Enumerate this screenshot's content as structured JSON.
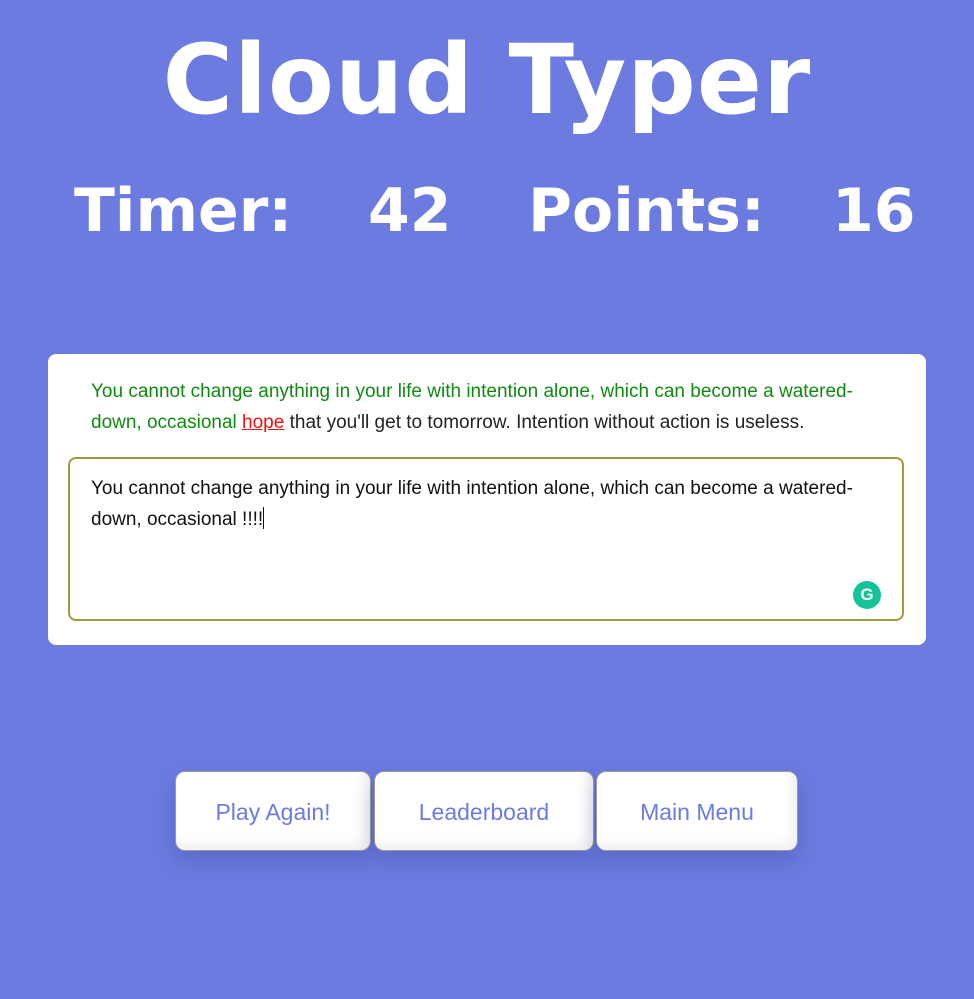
{
  "header": {
    "title": "Cloud Typer"
  },
  "stats": {
    "timer_label": "Timer:",
    "timer_value": "42",
    "points_label": "Points:",
    "points_value": "16"
  },
  "prompt": {
    "typed_correct": "You cannot change anything in your life with intention alone, which can become a watered-down, occasional",
    "current_word": "hope",
    "remaining": "that you'll get to tomorrow. Intention without action is useless."
  },
  "input": {
    "value": "You cannot change anything in your life with intention alone, which can become a watered-down, occasional !!!!"
  },
  "buttons": {
    "play_again": "Play Again!",
    "leaderboard": "Leaderboard",
    "main_menu": "Main Menu"
  },
  "colors": {
    "background": "#6c7be0",
    "correct_text": "#108a10",
    "current_word": "#ee1111",
    "button_text": "#6c7be0",
    "grammarly": "#15c39a"
  },
  "icons": {
    "grammarly": "grammarly-icon"
  }
}
